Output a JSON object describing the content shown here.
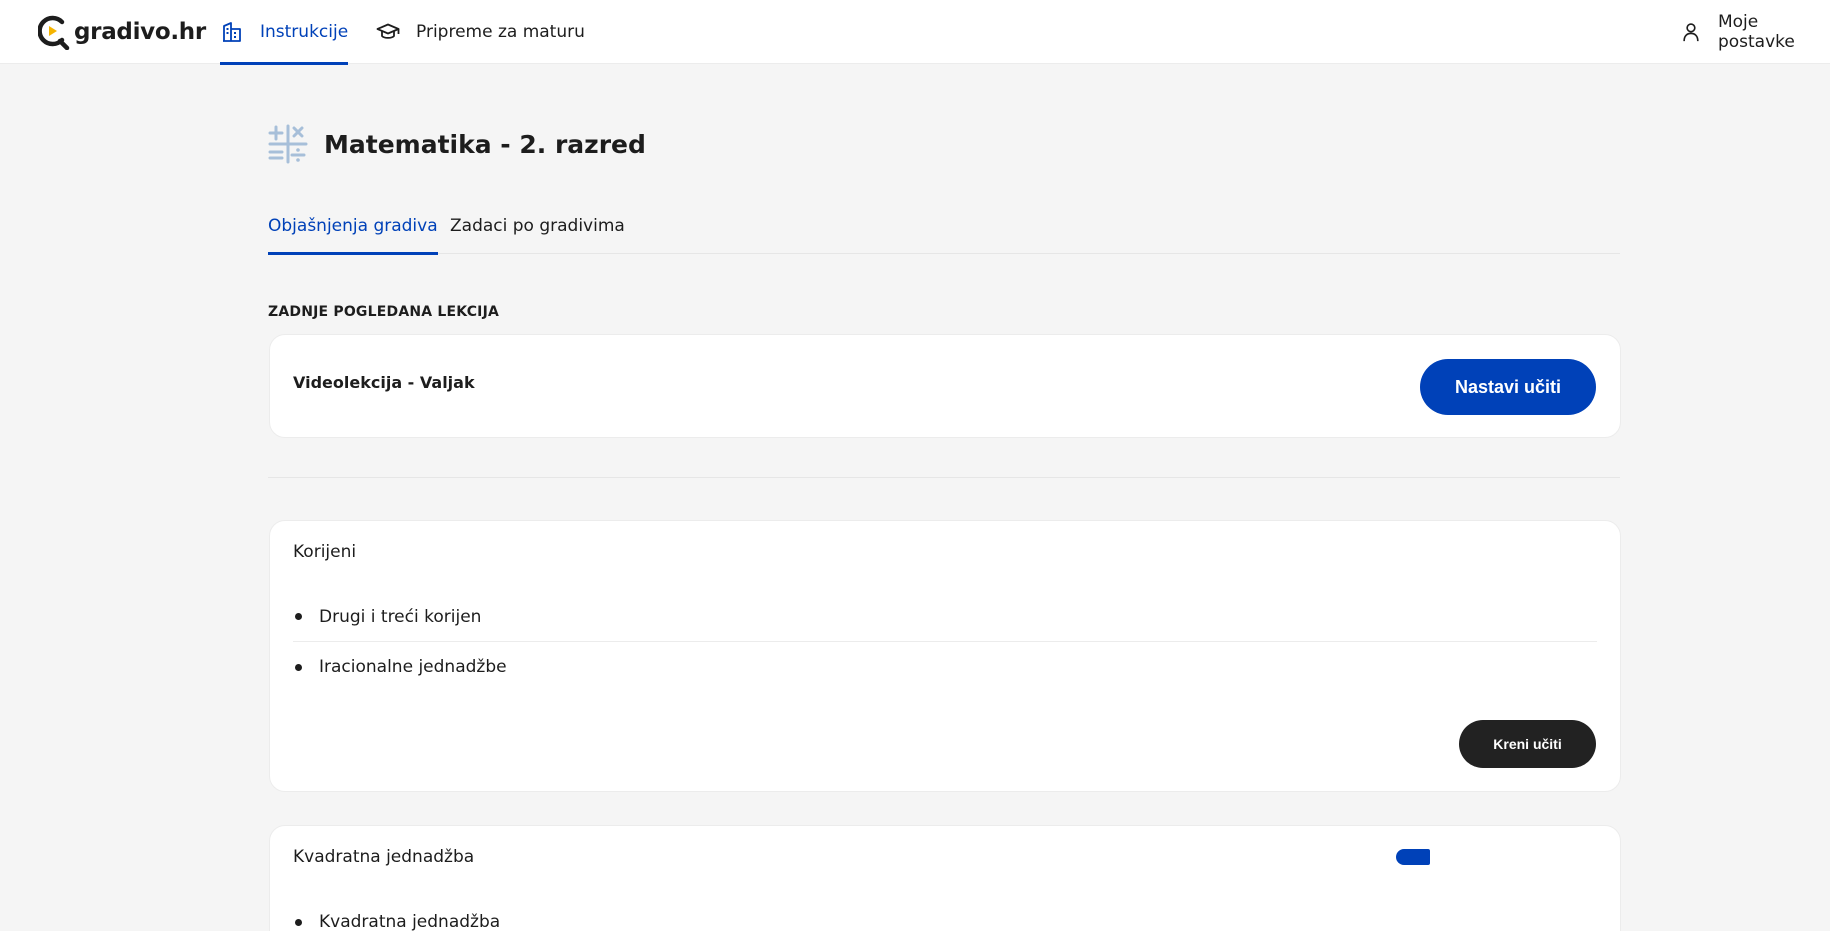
{
  "header": {
    "logo_text": "gradivo.hr",
    "nav": [
      {
        "label": "Instrukcije",
        "icon": "building-icon",
        "active": true
      },
      {
        "label": "Pripreme za maturu",
        "icon": "graduation-cap-icon",
        "active": false
      }
    ],
    "settings_label": "Moje postavke",
    "settings_icon": "user-icon"
  },
  "page": {
    "title": "Matematika - 2. razred",
    "title_icon": "math-operations-icon",
    "tabs": [
      {
        "label": "Objašnjenja gradiva",
        "active": true
      },
      {
        "label": "Zadaci po gradivima",
        "active": false
      }
    ]
  },
  "last_viewed": {
    "section_label": "ZADNJE POGLEDANA LEKCIJA",
    "lesson": "Videolekcija - Valjak",
    "button": "Nastavi učiti"
  },
  "topics": [
    {
      "title": "Korijeni",
      "items": [
        "Drugi i treći korijen",
        "Iracionalne jednadžbe"
      ],
      "button": "Kreni učiti"
    },
    {
      "title": "Kvadratna jednadžba",
      "items": [
        "Kvadratna jednadžba"
      ],
      "accent": "#0041b8"
    }
  ],
  "colors": {
    "accent": "#0041b8",
    "dark_button": "#222222",
    "background": "#f5f5f5"
  }
}
